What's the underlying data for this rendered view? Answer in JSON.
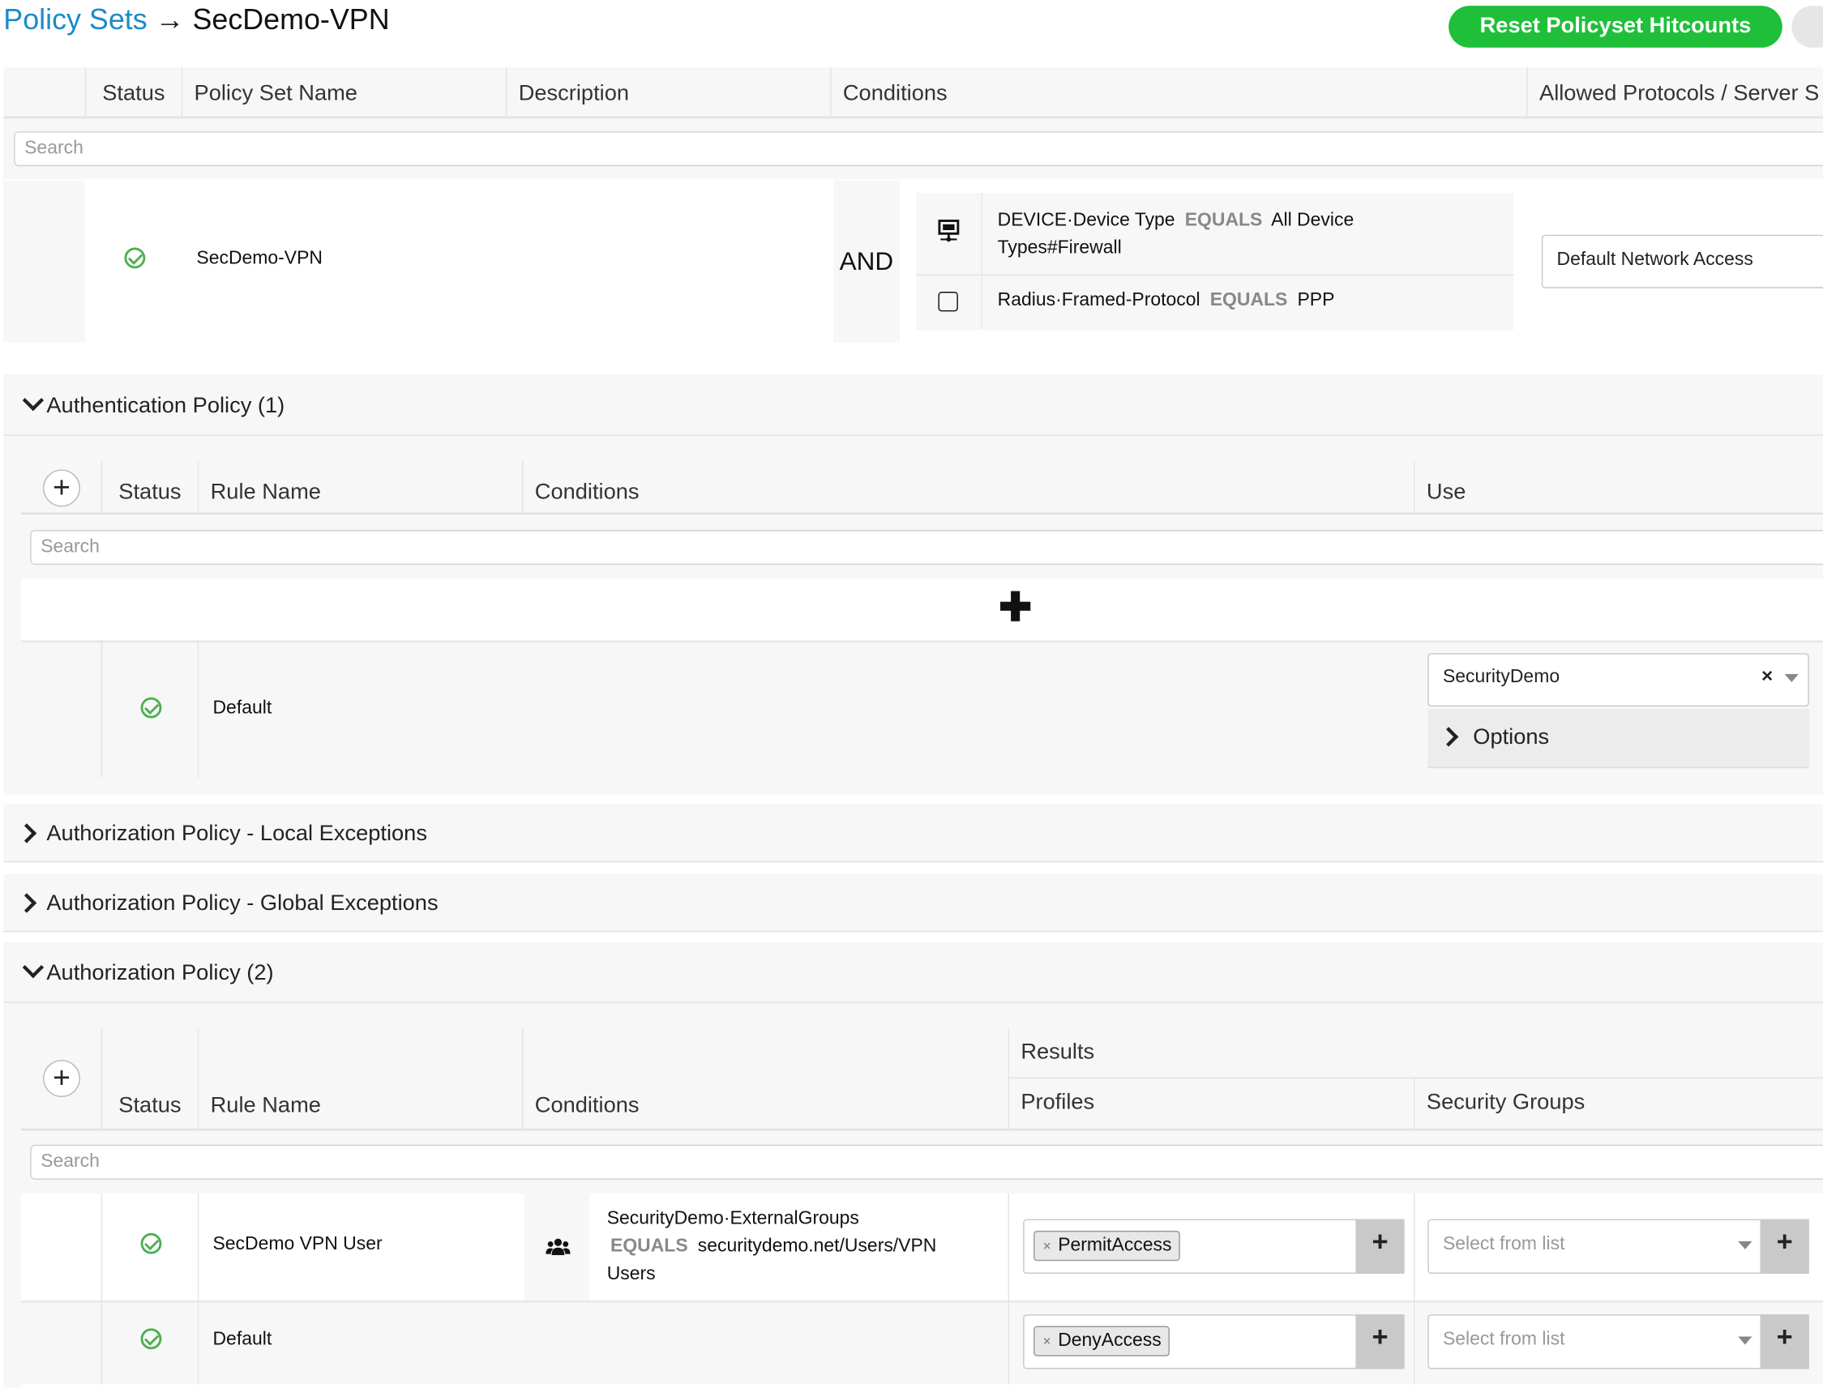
{
  "breadcrumb": {
    "root": "Policy Sets",
    "arrow": "→",
    "current": "SecDemo-VPN"
  },
  "reset_button": "Reset Policyset Hitcounts",
  "policy_set_table": {
    "headers": [
      "Status",
      "Policy Set Name",
      "Description",
      "Conditions",
      "Allowed Protocols / Server S"
    ],
    "search_placeholder": "Search",
    "row": {
      "name": "SecDemo-VPN",
      "description": "",
      "operator": "AND",
      "conditions": [
        {
          "icon": "device-icon",
          "attr": "DEVICE·Device Type",
          "op": "EQUALS",
          "value_line1": "All Device",
          "value_line2": "Types#Firewall"
        },
        {
          "icon": "checkbox-icon",
          "attr": "Radius·Framed-Protocol",
          "op": "EQUALS",
          "value": "PPP"
        }
      ],
      "allowed_protocols": "Default Network Access"
    }
  },
  "authentication": {
    "title": "Authentication Policy (1)",
    "headers": [
      "Status",
      "Rule Name",
      "Conditions",
      "Use"
    ],
    "search_placeholder": "Search",
    "add_plus": "✚",
    "rule": {
      "name": "Default",
      "use": "SecurityDemo",
      "clear": "×",
      "options": "Options"
    }
  },
  "local_exceptions": {
    "title": "Authorization Policy - Local Exceptions"
  },
  "global_exceptions": {
    "title": "Authorization Policy - Global Exceptions"
  },
  "authorization": {
    "title": "Authorization Policy (2)",
    "headers": {
      "status": "Status",
      "rule_name": "Rule Name",
      "conditions": "Conditions",
      "results": "Results",
      "profiles": "Profiles",
      "security_groups": "Security Groups"
    },
    "search_placeholder": "Search",
    "rules": [
      {
        "name": "SecDemo VPN User",
        "cond_line1": "SecurityDemo·ExternalGroups",
        "cond_op": "EQUALS",
        "cond_value": "securitydemo.net/Users/VPN",
        "cond_line3": "Users",
        "profile": "PermitAccess",
        "sg_placeholder": "Select from list"
      },
      {
        "name": "Default",
        "profile": "DenyAccess",
        "sg_placeholder": "Select from list"
      }
    ]
  },
  "colors": {
    "link": "#1a8bc9",
    "button_green": "#1fbf3a",
    "check_green": "#4caf50"
  }
}
